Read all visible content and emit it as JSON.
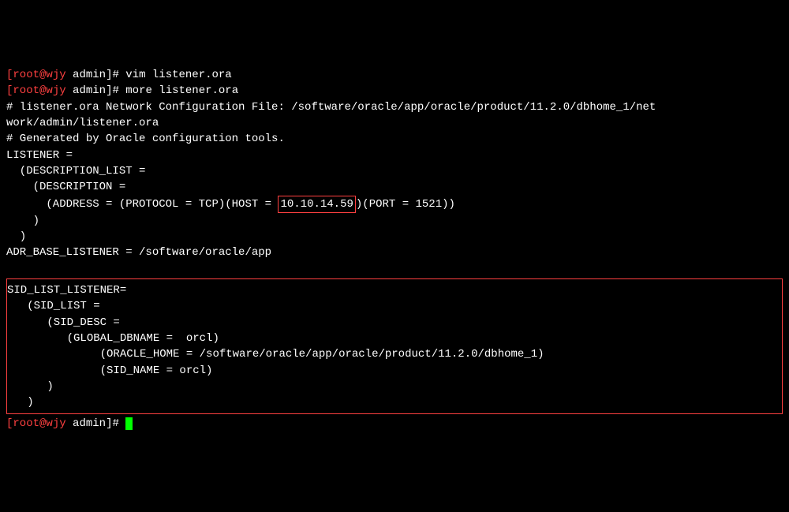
{
  "line0": {
    "user": "root",
    "at": "@",
    "host": "wjy",
    "path": " admin",
    "end": "]# ",
    "frag": "vim listener.ora"
  },
  "prompt1": {
    "open": "[",
    "user": "root",
    "at": "@",
    "host": "wjy",
    "path": " admin",
    "end": "]# ",
    "cmd": "more listener.ora"
  },
  "file": {
    "l1": "# listener.ora Network Configuration File: /software/oracle/app/oracle/product/11.2.0/dbhome_1/net",
    "l2": "work/admin/listener.ora",
    "l3": "# Generated by Oracle configuration tools.",
    "l4": "",
    "l5": "LISTENER =",
    "l6": "  (DESCRIPTION_LIST =",
    "l7": "    (DESCRIPTION =",
    "l8a": "      (ADDRESS = (PROTOCOL = TCP)(HOST = ",
    "ip": "10.10.14.59",
    "l8b": ")(PORT = 1521))",
    "l9": "    )",
    "l10": "  )",
    "l11": "",
    "l12": "ADR_BASE_LISTENER = /software/oracle/app",
    "block": {
      "b0": "",
      "b1": "SID_LIST_LISTENER=",
      "b2": "   (SID_LIST =",
      "b3": "      (SID_DESC =",
      "b4": "         (GLOBAL_DBNAME =  orcl)",
      "b5": "              (ORACLE_HOME = /software/oracle/app/oracle/product/11.2.0/dbhome_1)",
      "b6": "              (SID_NAME = orcl)",
      "b7": "      )",
      "b8": "   )"
    }
  },
  "prompt2": {
    "open": "[",
    "user": "root",
    "at": "@",
    "host": "wjy",
    "path": " admin",
    "end": "]# "
  }
}
